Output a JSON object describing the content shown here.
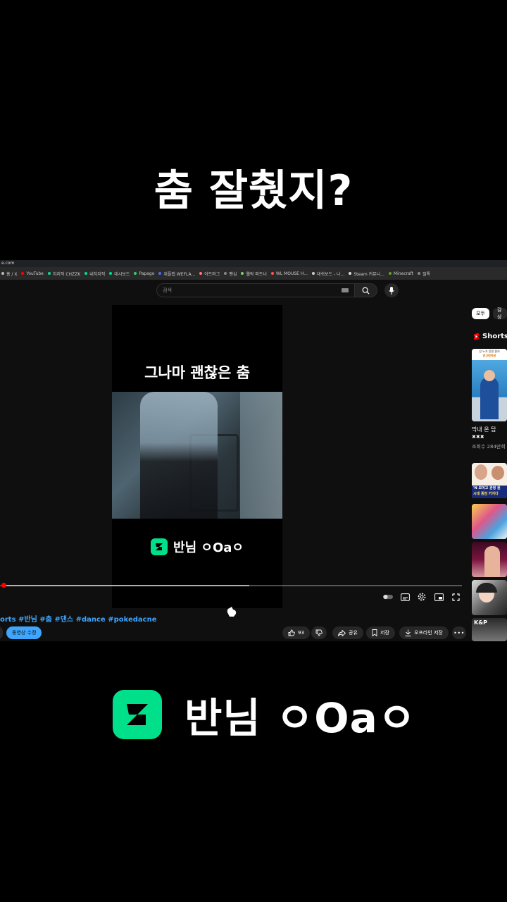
{
  "caption_top": "춤 잘췄지?",
  "browser": {
    "url_fragment": "e.com",
    "bookmarks": [
      {
        "label": "홈 / X",
        "color": "#bbbbbb"
      },
      {
        "label": "YouTube",
        "color": "#ff0000"
      },
      {
        "label": "치지직 CHZZK",
        "color": "#00e08a"
      },
      {
        "label": "내치지직",
        "color": "#00e08a"
      },
      {
        "label": "대시보드",
        "color": "#00e08a"
      },
      {
        "label": "Papago",
        "color": "#2ed36a"
      },
      {
        "label": "위플랩 WEFLA...",
        "color": "#4a6cff"
      },
      {
        "label": "아트머그",
        "color": "#ff7a7a"
      },
      {
        "label": "팬심",
        "color": "#888888"
      },
      {
        "label": "웰락 파트너",
        "color": "#7ad36a"
      },
      {
        "label": "WL MOUSE H...",
        "color": "#ff5555"
      },
      {
        "label": "대쉬보드 - 나...",
        "color": "#cccccc"
      },
      {
        "label": "Steam 커뮤니...",
        "color": "#dddddd"
      },
      {
        "label": "Minecraft",
        "color": "#5aa02c"
      },
      {
        "label": "질톡",
        "color": "#888888"
      }
    ]
  },
  "search": {
    "placeholder": "검색"
  },
  "player": {
    "inner_title": "그나마 괜찮은 춤",
    "inner_channel": "반님 ㅇOaㅇ",
    "progress_fraction": 0.005,
    "buffer_fraction": 0.54
  },
  "video": {
    "tags": "orts #반님 #춤 #댄스 #dance #pokedacne",
    "edit_label": "동영상 수정",
    "like_count": "93",
    "share_label": "공유",
    "save_label": "저장",
    "download_label": "오프라인 저장"
  },
  "sidebar": {
    "chips": [
      "모두",
      "감상"
    ],
    "shorts_label": "Shorts",
    "first_short_title": "막내 온 탑",
    "first_short_sub": "✖✖✖",
    "first_short_meta": "조회수 284만회",
    "thumb_top_text": "잉 누가 증원 원하",
    "thumb_highlight": "운고런하네",
    "thumb_line1": "'N 모여고 관청 원",
    "thumb_line2": "시대 종점 커지다",
    "thumb_kp": "K&P"
  },
  "brand": {
    "name": "반님 ㅇOaㅇ"
  },
  "colors": {
    "accent": "#00e08a",
    "link": "#3ea6ff",
    "progress": "#ff0000"
  }
}
